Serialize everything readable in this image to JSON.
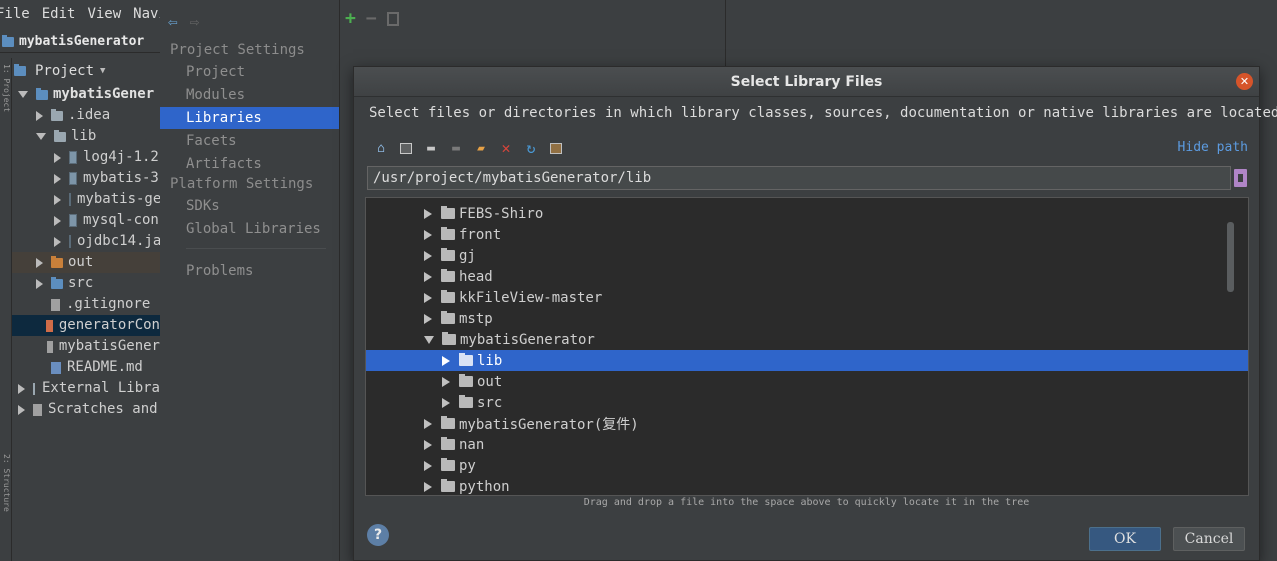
{
  "ide": {
    "menu": [
      "File",
      "Edit",
      "View",
      "Navi"
    ],
    "project_title": "mybatisGenerator",
    "side_labels": [
      "1: Project",
      "2: Structure"
    ],
    "project_view_label": "Project",
    "tree": [
      {
        "label": "mybatisGener",
        "depth": 0,
        "expanded": true,
        "icon": "module-folder-icon",
        "bold": true
      },
      {
        "label": ".idea",
        "depth": 1,
        "expanded": false,
        "icon": "folder-icon"
      },
      {
        "label": "lib",
        "depth": 1,
        "expanded": true,
        "icon": "folder-icon"
      },
      {
        "label": "log4j-1.2",
        "depth": 2,
        "expanded": false,
        "icon": "jar-icon"
      },
      {
        "label": "mybatis-3",
        "depth": 2,
        "expanded": false,
        "icon": "jar-icon"
      },
      {
        "label": "mybatis-ge",
        "depth": 2,
        "expanded": false,
        "icon": "jar-icon"
      },
      {
        "label": "mysql-con",
        "depth": 2,
        "expanded": false,
        "icon": "jar-icon"
      },
      {
        "label": "ojdbc14.ja",
        "depth": 2,
        "expanded": false,
        "icon": "jar-icon"
      },
      {
        "label": "out",
        "depth": 1,
        "expanded": false,
        "icon": "orange-folder-icon",
        "highlight": true
      },
      {
        "label": "src",
        "depth": 1,
        "expanded": false,
        "icon": "blue-folder-icon"
      },
      {
        "label": ".gitignore",
        "depth": 1,
        "icon": "file-icon"
      },
      {
        "label": "generatorCon",
        "depth": 1,
        "icon": "xml-file-icon",
        "selected": true
      },
      {
        "label": "mybatisGener",
        "depth": 1,
        "icon": "file-icon"
      },
      {
        "label": "README.md",
        "depth": 1,
        "icon": "markdown-file-icon"
      },
      {
        "label": "External Libra",
        "depth": 0,
        "expanded": false,
        "icon": "library-icon"
      },
      {
        "label": "Scratches and",
        "depth": 0,
        "expanded": false,
        "icon": "scratches-icon"
      }
    ]
  },
  "settings": {
    "project_settings_header": "Project Settings",
    "platform_settings_header": "Platform Settings",
    "items": {
      "project": "Project",
      "modules": "Modules",
      "libraries": "Libraries",
      "facets": "Facets",
      "artifacts": "Artifacts",
      "sdks": "SDKs",
      "global_libraries": "Global Libraries",
      "problems": "Problems"
    },
    "active": "Libraries"
  },
  "library_toolbar": {
    "add": "+",
    "remove": "−"
  },
  "dialog": {
    "title": "Select Library Files",
    "description": "Select files or directories in which library classes, sources, documentation or native libraries are located",
    "hide_path": "Hide path",
    "path": "/usr/project/mybatisGenerator/lib",
    "tree": [
      {
        "label": "FEBS-Shiro",
        "depth": 0,
        "expanded": false
      },
      {
        "label": "front",
        "depth": 0,
        "expanded": false
      },
      {
        "label": "gj",
        "depth": 0,
        "expanded": false
      },
      {
        "label": "head",
        "depth": 0,
        "expanded": false
      },
      {
        "label": "kkFileView-master",
        "depth": 0,
        "expanded": false
      },
      {
        "label": "mstp",
        "depth": 0,
        "expanded": false
      },
      {
        "label": "mybatisGenerator",
        "depth": 0,
        "expanded": true
      },
      {
        "label": "lib",
        "depth": 1,
        "expanded": false,
        "selected": true
      },
      {
        "label": "out",
        "depth": 1,
        "expanded": false
      },
      {
        "label": "src",
        "depth": 1,
        "expanded": false
      },
      {
        "label": "mybatisGenerator(复件)",
        "depth": 0,
        "expanded": false
      },
      {
        "label": "nan",
        "depth": 0,
        "expanded": false
      },
      {
        "label": "py",
        "depth": 0,
        "expanded": false
      },
      {
        "label": "python",
        "depth": 0,
        "expanded": false
      }
    ],
    "drag_hint": "Drag and drop a file into the space above to quickly locate it in the tree",
    "help": "?",
    "ok": "OK",
    "cancel": "Cancel"
  },
  "colors": {
    "accent": "#2f65ca",
    "background": "#3c3f41",
    "tree_background": "#2b2b2b",
    "close": "#d6542a",
    "link": "#5c9be0"
  }
}
